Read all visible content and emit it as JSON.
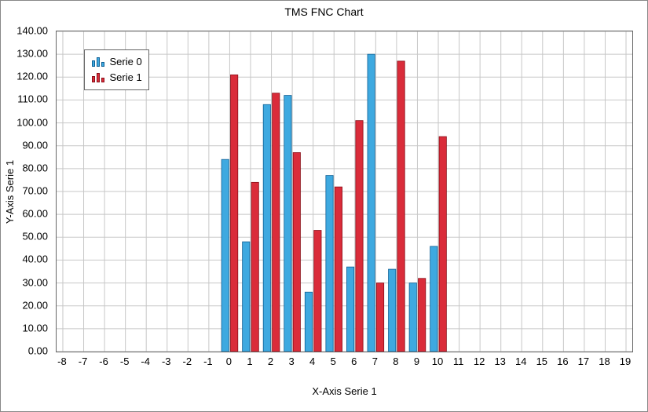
{
  "chart_data": {
    "type": "bar",
    "title": "TMS FNC Chart",
    "xlabel": "X-Axis Serie 1",
    "ylabel": "Y-Axis Serie 1",
    "x_ticks": [
      "-8",
      "-7",
      "-6",
      "-5",
      "-4",
      "-3",
      "-2",
      "-1",
      "0",
      "1",
      "2",
      "3",
      "4",
      "5",
      "6",
      "7",
      "8",
      "9",
      "10",
      "11",
      "12",
      "13",
      "14",
      "15",
      "16",
      "17",
      "18",
      "19"
    ],
    "y_ticks": [
      "0.00",
      "10.00",
      "20.00",
      "30.00",
      "40.00",
      "50.00",
      "60.00",
      "70.00",
      "80.00",
      "90.00",
      "100.00",
      "110.00",
      "120.00",
      "130.00",
      "140.00"
    ],
    "xlim": [
      -8.3,
      19.3
    ],
    "ylim": [
      0,
      140
    ],
    "categories": [
      0,
      1,
      2,
      3,
      4,
      5,
      6,
      7,
      8,
      9,
      10
    ],
    "series": [
      {
        "name": "Serie 0",
        "values": [
          84,
          48,
          108,
          112,
          26,
          77,
          37,
          130,
          36,
          30,
          46
        ]
      },
      {
        "name": "Serie 1",
        "values": [
          121,
          74,
          113,
          87,
          53,
          72,
          101,
          30,
          127,
          32,
          94
        ]
      }
    ],
    "legend": {
      "position": "top-left-inside"
    },
    "colors": {
      "serie0": "#3ea9e0",
      "serie1": "#da2c3a",
      "grid": "#c7c7c7"
    }
  }
}
